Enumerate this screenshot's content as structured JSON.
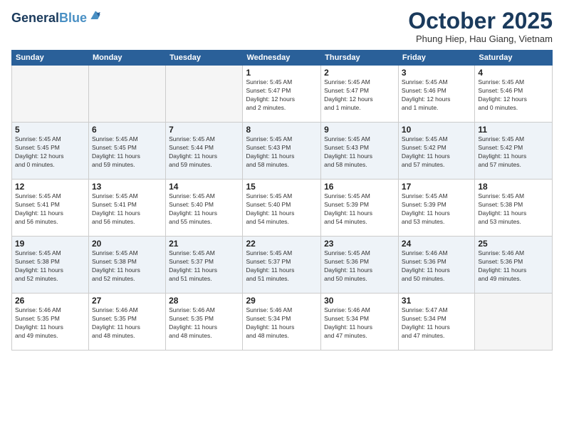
{
  "header": {
    "logo_line1": "General",
    "logo_line2": "Blue",
    "month": "October 2025",
    "location": "Phung Hiep, Hau Giang, Vietnam"
  },
  "days_of_week": [
    "Sunday",
    "Monday",
    "Tuesday",
    "Wednesday",
    "Thursday",
    "Friday",
    "Saturday"
  ],
  "weeks": [
    {
      "alt": false,
      "days": [
        {
          "num": "",
          "info": ""
        },
        {
          "num": "",
          "info": ""
        },
        {
          "num": "",
          "info": ""
        },
        {
          "num": "1",
          "info": "Sunrise: 5:45 AM\nSunset: 5:47 PM\nDaylight: 12 hours\nand 2 minutes."
        },
        {
          "num": "2",
          "info": "Sunrise: 5:45 AM\nSunset: 5:47 PM\nDaylight: 12 hours\nand 1 minute."
        },
        {
          "num": "3",
          "info": "Sunrise: 5:45 AM\nSunset: 5:46 PM\nDaylight: 12 hours\nand 1 minute."
        },
        {
          "num": "4",
          "info": "Sunrise: 5:45 AM\nSunset: 5:46 PM\nDaylight: 12 hours\nand 0 minutes."
        }
      ]
    },
    {
      "alt": true,
      "days": [
        {
          "num": "5",
          "info": "Sunrise: 5:45 AM\nSunset: 5:45 PM\nDaylight: 12 hours\nand 0 minutes."
        },
        {
          "num": "6",
          "info": "Sunrise: 5:45 AM\nSunset: 5:45 PM\nDaylight: 11 hours\nand 59 minutes."
        },
        {
          "num": "7",
          "info": "Sunrise: 5:45 AM\nSunset: 5:44 PM\nDaylight: 11 hours\nand 59 minutes."
        },
        {
          "num": "8",
          "info": "Sunrise: 5:45 AM\nSunset: 5:43 PM\nDaylight: 11 hours\nand 58 minutes."
        },
        {
          "num": "9",
          "info": "Sunrise: 5:45 AM\nSunset: 5:43 PM\nDaylight: 11 hours\nand 58 minutes."
        },
        {
          "num": "10",
          "info": "Sunrise: 5:45 AM\nSunset: 5:42 PM\nDaylight: 11 hours\nand 57 minutes."
        },
        {
          "num": "11",
          "info": "Sunrise: 5:45 AM\nSunset: 5:42 PM\nDaylight: 11 hours\nand 57 minutes."
        }
      ]
    },
    {
      "alt": false,
      "days": [
        {
          "num": "12",
          "info": "Sunrise: 5:45 AM\nSunset: 5:41 PM\nDaylight: 11 hours\nand 56 minutes."
        },
        {
          "num": "13",
          "info": "Sunrise: 5:45 AM\nSunset: 5:41 PM\nDaylight: 11 hours\nand 56 minutes."
        },
        {
          "num": "14",
          "info": "Sunrise: 5:45 AM\nSunset: 5:40 PM\nDaylight: 11 hours\nand 55 minutes."
        },
        {
          "num": "15",
          "info": "Sunrise: 5:45 AM\nSunset: 5:40 PM\nDaylight: 11 hours\nand 54 minutes."
        },
        {
          "num": "16",
          "info": "Sunrise: 5:45 AM\nSunset: 5:39 PM\nDaylight: 11 hours\nand 54 minutes."
        },
        {
          "num": "17",
          "info": "Sunrise: 5:45 AM\nSunset: 5:39 PM\nDaylight: 11 hours\nand 53 minutes."
        },
        {
          "num": "18",
          "info": "Sunrise: 5:45 AM\nSunset: 5:38 PM\nDaylight: 11 hours\nand 53 minutes."
        }
      ]
    },
    {
      "alt": true,
      "days": [
        {
          "num": "19",
          "info": "Sunrise: 5:45 AM\nSunset: 5:38 PM\nDaylight: 11 hours\nand 52 minutes."
        },
        {
          "num": "20",
          "info": "Sunrise: 5:45 AM\nSunset: 5:38 PM\nDaylight: 11 hours\nand 52 minutes."
        },
        {
          "num": "21",
          "info": "Sunrise: 5:45 AM\nSunset: 5:37 PM\nDaylight: 11 hours\nand 51 minutes."
        },
        {
          "num": "22",
          "info": "Sunrise: 5:45 AM\nSunset: 5:37 PM\nDaylight: 11 hours\nand 51 minutes."
        },
        {
          "num": "23",
          "info": "Sunrise: 5:45 AM\nSunset: 5:36 PM\nDaylight: 11 hours\nand 50 minutes."
        },
        {
          "num": "24",
          "info": "Sunrise: 5:46 AM\nSunset: 5:36 PM\nDaylight: 11 hours\nand 50 minutes."
        },
        {
          "num": "25",
          "info": "Sunrise: 5:46 AM\nSunset: 5:36 PM\nDaylight: 11 hours\nand 49 minutes."
        }
      ]
    },
    {
      "alt": false,
      "days": [
        {
          "num": "26",
          "info": "Sunrise: 5:46 AM\nSunset: 5:35 PM\nDaylight: 11 hours\nand 49 minutes."
        },
        {
          "num": "27",
          "info": "Sunrise: 5:46 AM\nSunset: 5:35 PM\nDaylight: 11 hours\nand 48 minutes."
        },
        {
          "num": "28",
          "info": "Sunrise: 5:46 AM\nSunset: 5:35 PM\nDaylight: 11 hours\nand 48 minutes."
        },
        {
          "num": "29",
          "info": "Sunrise: 5:46 AM\nSunset: 5:34 PM\nDaylight: 11 hours\nand 48 minutes."
        },
        {
          "num": "30",
          "info": "Sunrise: 5:46 AM\nSunset: 5:34 PM\nDaylight: 11 hours\nand 47 minutes."
        },
        {
          "num": "31",
          "info": "Sunrise: 5:47 AM\nSunset: 5:34 PM\nDaylight: 11 hours\nand 47 minutes."
        },
        {
          "num": "",
          "info": ""
        }
      ]
    }
  ]
}
